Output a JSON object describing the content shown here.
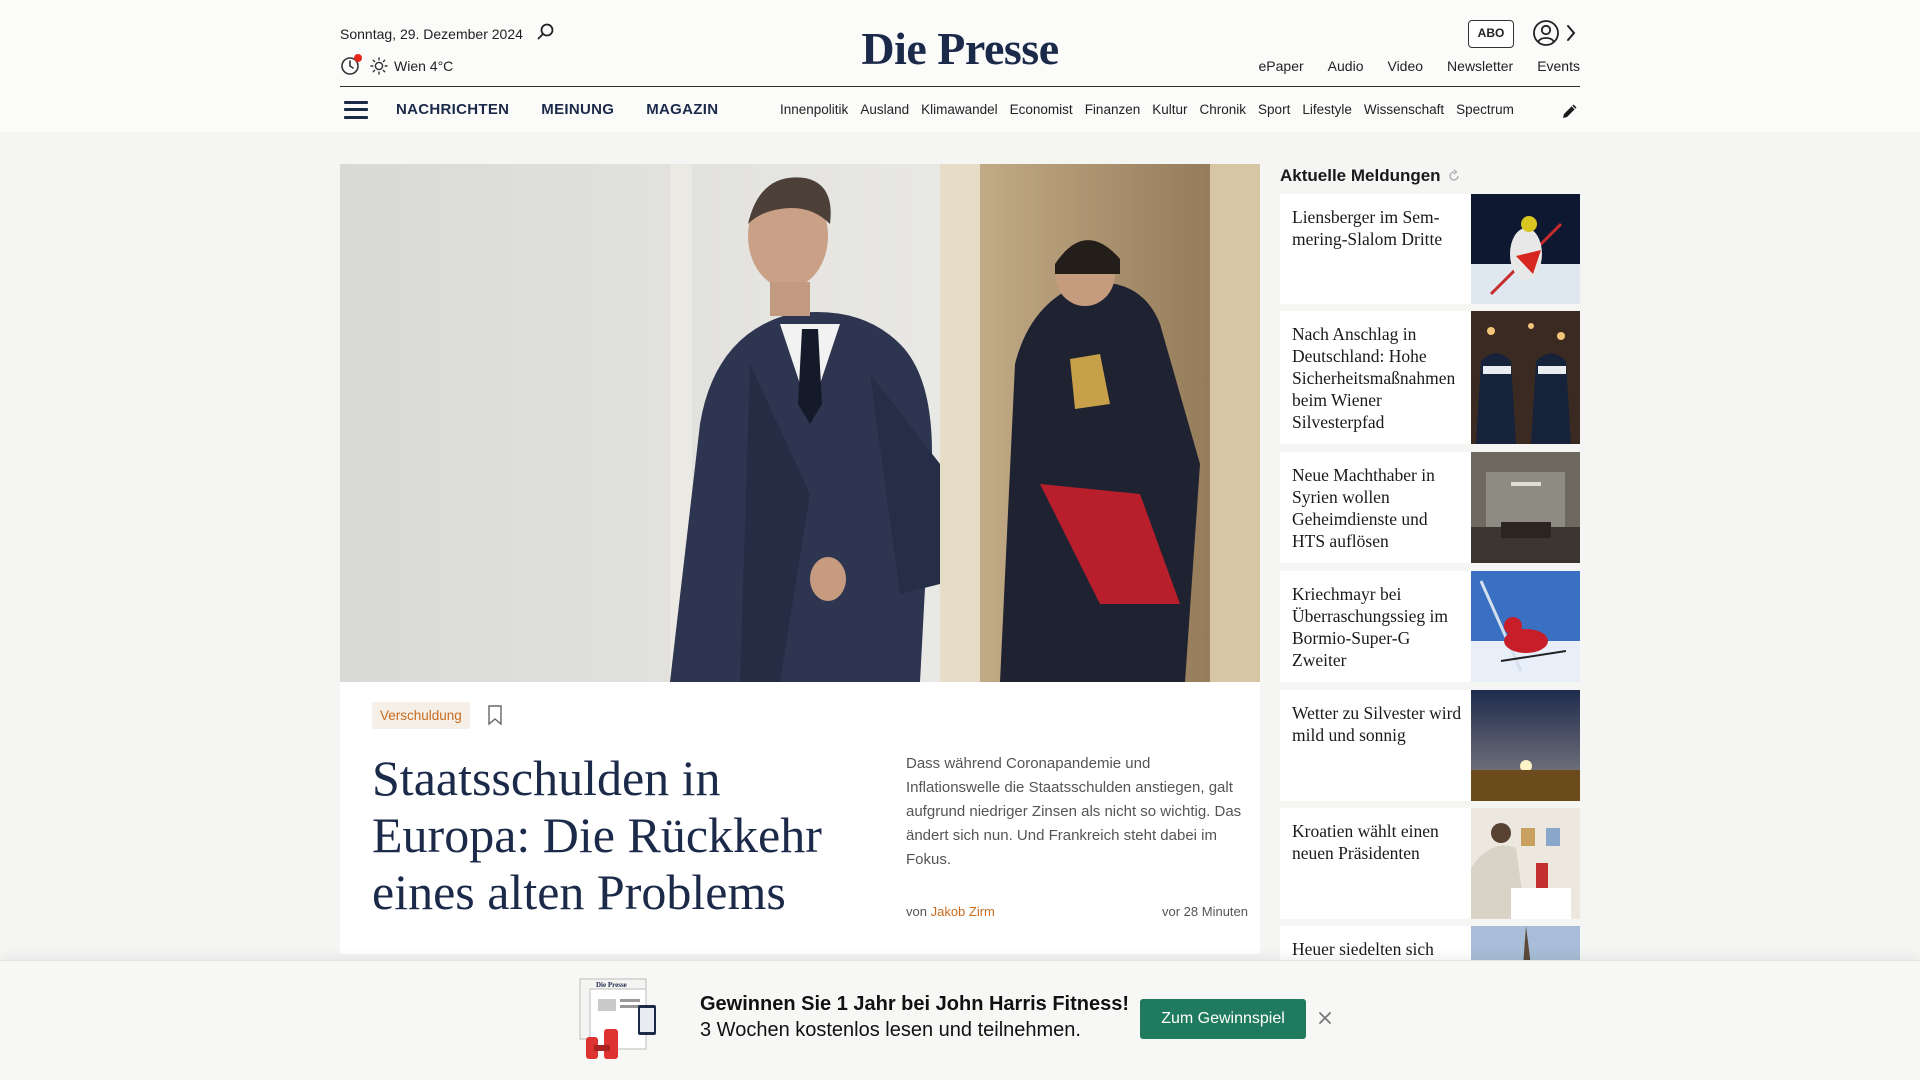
{
  "header": {
    "date": "Sonntag, 29. Dezember 2024",
    "weather": "Wien 4°C",
    "logo": "Die Presse",
    "abo_label": "ABO",
    "top_links": [
      "ePaper",
      "Audio",
      "Video",
      "Newsletter",
      "Events"
    ],
    "nav_main": [
      "NACHRICHTEN",
      "MEINUNG",
      "MAGAZIN"
    ],
    "nav_sections": [
      "Innenpolitik",
      "Ausland",
      "Klimawandel",
      "Economist",
      "Finanzen",
      "Kultur",
      "Chronik",
      "Sport",
      "Lifestyle",
      "Wissenschaft",
      "Spectrum"
    ]
  },
  "hero": {
    "tag": "Verschuldung",
    "headline": "Staatsschulden in Europa: Die Rückkehr eines alten Problems",
    "teaser": "Dass während Coronapandemie und Inflationswelle die Staatsschulden anstiegen, galt aufgrund niedriger Zinsen als nicht so wichtig. Das ändert sich nun. Und Frankreich steht dabei im Fokus.",
    "byline_prefix": "von",
    "author": "Jakob Zirm",
    "time": "vor 28 Minuten"
  },
  "sidebar": {
    "title": "Aktuelle Meldungen",
    "items": [
      {
        "title": "Liensberger im Sem­mering-Slalom Dritte"
      },
      {
        "title": "Nach Anschlag in Deutschland: Hohe Sicherheits­maßnahmen beim Wiener Silvesterpfad"
      },
      {
        "title": "Neue Machthaber in Syrien wollen Geheimdienste und HTS auflösen"
      },
      {
        "title": "Kriechmayr bei Überraschungssieg im Bormio-Super-G Zweiter"
      },
      {
        "title": "Wetter zu Silvester wird mild und sonnig"
      },
      {
        "title": "Kroatien wählt einen neuen Präsidenten"
      },
      {
        "title": "Heuer siedelten sich"
      }
    ]
  },
  "promo": {
    "line1": "Gewinnen Sie 1 Jahr bei John Harris Fitness!",
    "line2": "3 Wochen kostenlos lesen und teilnehmen.",
    "button": "Zum Gewinnspiel",
    "mini_logo": "Die Presse"
  },
  "colors": {
    "brand_navy": "#1c2a4a",
    "accent_orange": "#c86b1f",
    "cta_green": "#1f7a5e"
  }
}
